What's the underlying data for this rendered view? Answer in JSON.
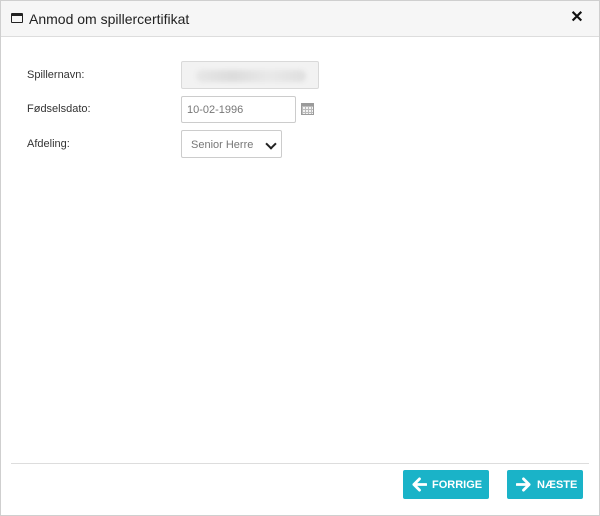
{
  "dialog": {
    "title": "Anmod om spillercertifikat",
    "close_glyph": "✕",
    "title_icon": "window-icon",
    "close_icon": "close-icon"
  },
  "form": {
    "player_name_label": "Spillernavn:",
    "birthdate_label": "Fødselsdato:",
    "birthdate_value": "10-02-1996",
    "department_label": "Afdeling:",
    "department_value": "Senior Herre",
    "calendar_icon": "calendar-icon"
  },
  "footer": {
    "prev_label": "FORRIGE",
    "next_label": "NÆSTE",
    "button_color": "#1ab3c8",
    "prev_icon": "arrow-left-icon",
    "next_icon": "arrow-right-icon"
  }
}
